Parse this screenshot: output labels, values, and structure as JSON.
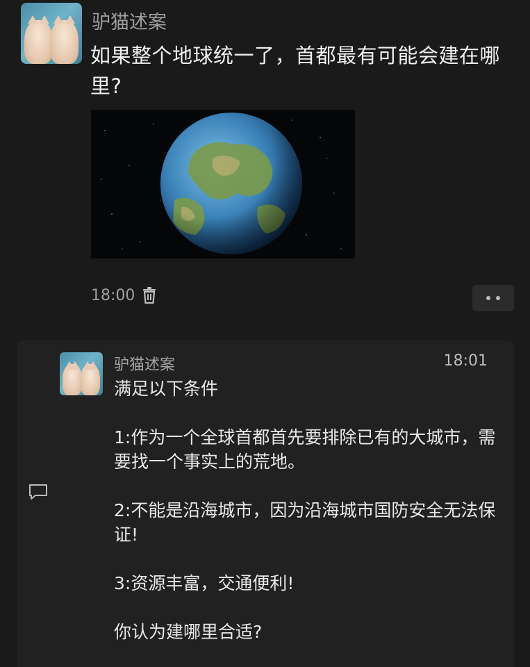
{
  "post": {
    "author": "驴猫述案",
    "question": "如果整个地球统一了，首都最有可能会建在哪里?",
    "time": "18:00",
    "image_icon": "globe-image",
    "delete_icon": "trash-icon",
    "more_icon": "more-dots-icon"
  },
  "reply": {
    "author": "驴猫述案",
    "time": "18:01",
    "paragraphs": [
      "满足以下条件",
      "1:作为一个全球首都首先要排除已有的大城市，需要找一个事实上的荒地。",
      "2:不能是沿海城市，因为沿海城市国防安全无法保证!",
      "3:资源丰富，交通便利!",
      "你认为建哪里合适?"
    ],
    "comment_icon": "comment-icon"
  },
  "colors": {
    "background": "#1a1a1a",
    "card": "#212121",
    "text_primary": "#f0f0f0",
    "text_secondary": "#9e9e9e"
  }
}
